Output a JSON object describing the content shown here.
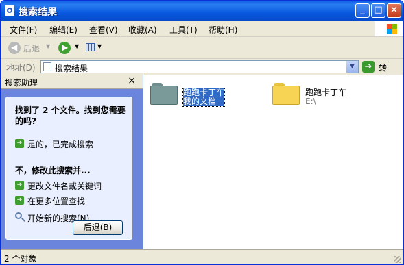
{
  "window": {
    "title": "搜索结果"
  },
  "menu": [
    "文件(F)",
    "编辑(E)",
    "查看(V)",
    "收藏(A)",
    "工具(T)",
    "帮助(H)"
  ],
  "toolbar": {
    "back_label": "后退"
  },
  "address": {
    "label": "地址(D)",
    "value": "搜索结果",
    "go_label": "转到"
  },
  "search_pane": {
    "title": "搜索助理",
    "close_glyph": "×",
    "found_message": "找到了 2 个文件。找到您需要的吗?",
    "yes_option": "是的，已完成搜索",
    "refine_heading": "不，修改此搜索并...",
    "change_option": "更改文件名或关键词",
    "more_places_option": "在更多位置查找",
    "new_search_link": "开始新的搜索(N)",
    "back_button": "后退(B)"
  },
  "results": [
    {
      "name": "跑跑卡丁车",
      "location": "我的文档",
      "selected": true
    },
    {
      "name": "跑跑卡丁车",
      "location": "E:\\",
      "selected": false
    }
  ],
  "status": {
    "text": "2 个对象"
  },
  "colors": {
    "titlebar": "#0858de",
    "pane_bg": "#6b85dc",
    "panel_bg": "#e9effe",
    "selection": "#316ac5",
    "folder_yellow": "#f7d454"
  }
}
